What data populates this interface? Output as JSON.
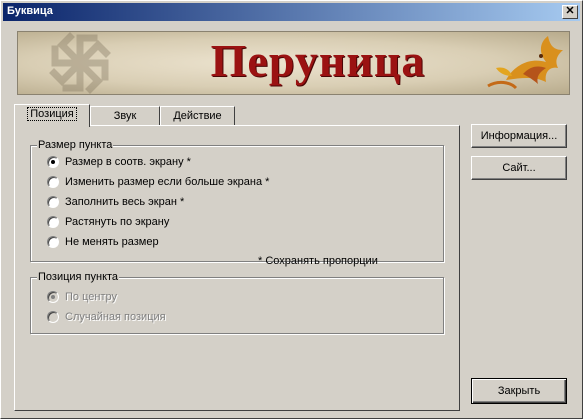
{
  "window": {
    "title": "Буквица"
  },
  "banner": {
    "title": "Перуница"
  },
  "tabs": [
    {
      "label": "Позиция",
      "active": true
    },
    {
      "label": "Звук",
      "active": false
    },
    {
      "label": "Действие",
      "active": false
    }
  ],
  "size_group": {
    "legend": "Размер пункта",
    "options": [
      {
        "label": "Размер в соотв. экрану *",
        "checked": true
      },
      {
        "label": "Изменить размер если больше экрана *",
        "checked": false
      },
      {
        "label": "Заполнить весь экран *",
        "checked": false
      },
      {
        "label": "Растянуть по экрану",
        "checked": false
      },
      {
        "label": "Не менять размер",
        "checked": false
      }
    ],
    "note": "* Сохранять пропорции"
  },
  "position_group": {
    "legend": "Позиция пункта",
    "enabled": false,
    "options": [
      {
        "label": "По центру",
        "checked": true
      },
      {
        "label": "Случайная позиция",
        "checked": false
      }
    ]
  },
  "buttons": {
    "info": "Информация...",
    "site": "Сайт...",
    "close": "Закрыть"
  },
  "icons": {
    "close": "close-icon"
  }
}
